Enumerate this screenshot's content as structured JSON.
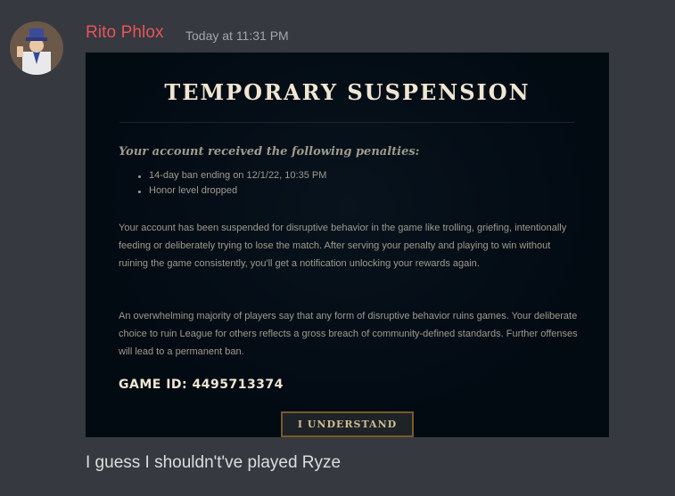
{
  "message": {
    "author": "Rito Phlox",
    "timestamp": "Today at 11:31 PM",
    "text": "I guess I shouldn't've played Ryze",
    "author_color": "#e6555a"
  },
  "embed": {
    "title": "TEMPORARY SUSPENSION",
    "penalties_heading": "Your account received the following penalties:",
    "penalties": [
      "14-day ban ending on 12/1/22, 10:35 PM",
      "Honor level dropped"
    ],
    "paragraph1": "Your account has been suspended for disruptive behavior in the game like trolling, griefing, intentionally feeding or deliberately trying to lose the match. After serving your penalty and playing to win without ruining the game consistently, you'll get a notification unlocking your rewards again.",
    "paragraph2": "An overwhelming majority of players say that any form of disruptive behavior ruins games. Your deliberate choice to ruin League for others reflects a gross breach of community-defined standards. Further offenses will lead to a permanent ban.",
    "game_id": "GAME ID: 4495713374",
    "button_label": "I UNDERSTAND"
  },
  "icons": {
    "avatar": "avatar-icon"
  }
}
